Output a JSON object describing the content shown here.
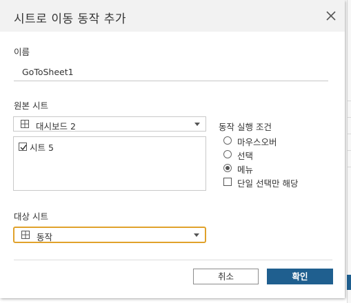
{
  "dialog": {
    "title": "시트로 이동 동작 추가",
    "name_label": "이름",
    "name_value": "GoToSheet1",
    "source_label": "원본 시트",
    "source_selected": "대시보드 2",
    "sheets": [
      {
        "label": "시트 5",
        "checked": true
      }
    ],
    "trigger_label": "동작 실행 조건",
    "trigger_options": [
      {
        "label": "마우스오버",
        "kind": "radio",
        "selected": false
      },
      {
        "label": "선택",
        "kind": "radio",
        "selected": false
      },
      {
        "label": "메뉴",
        "kind": "radio",
        "selected": true
      },
      {
        "label": "단일 선택만 해당",
        "kind": "checkbox",
        "selected": false
      }
    ],
    "target_label": "대상 시트",
    "target_selected": "동작",
    "cancel_label": "취소",
    "ok_label": "확인"
  },
  "colors": {
    "primary": "#1f5f8f",
    "focus_border": "#e0a12a",
    "titlebar": "#f2f2f2"
  },
  "icons": [
    "close-icon",
    "grid-icon",
    "dropdown-arrow-icon",
    "checkmark-icon"
  ]
}
